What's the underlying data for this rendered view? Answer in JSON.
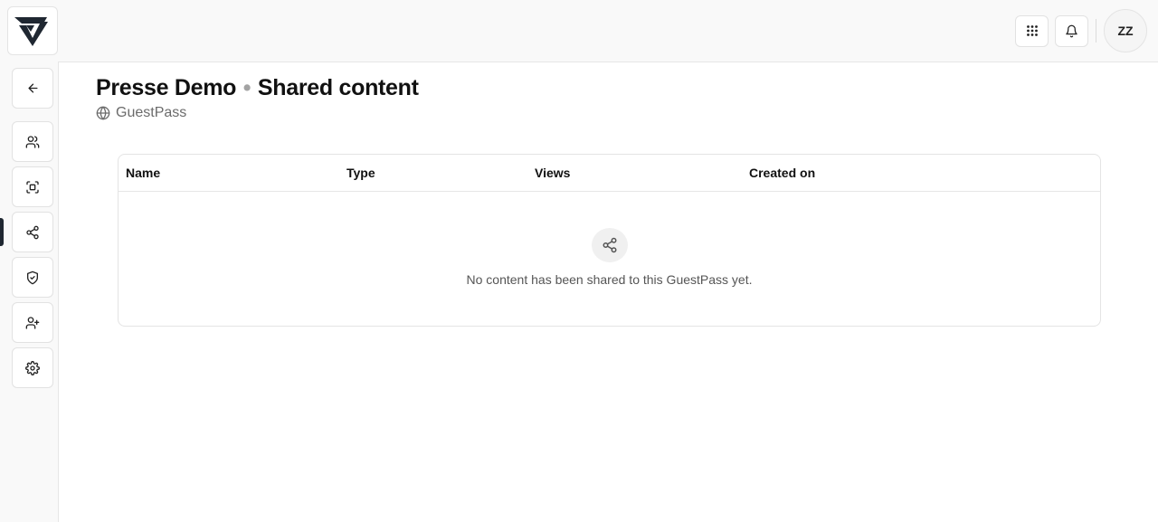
{
  "header": {
    "apps_icon": "grid-icon",
    "notifications_icon": "bell-icon",
    "avatar_initials": "ZZ"
  },
  "sidebar": {
    "items": [
      {
        "name": "back",
        "icon": "arrow-left-icon"
      },
      {
        "name": "users",
        "icon": "users-icon"
      },
      {
        "name": "scan",
        "icon": "scan-icon"
      },
      {
        "name": "share",
        "icon": "share-icon",
        "active": true
      },
      {
        "name": "security",
        "icon": "shield-icon"
      },
      {
        "name": "invite",
        "icon": "user-plus-icon"
      },
      {
        "name": "settings",
        "icon": "gear-icon"
      }
    ]
  },
  "page": {
    "title_main": "Presse Demo",
    "title_separator": "•",
    "title_section": "Shared content",
    "subtitle": "GuestPass"
  },
  "table": {
    "columns": [
      "Name",
      "Type",
      "Views",
      "Created on"
    ],
    "empty_message": "No content has been shared to this GuestPass yet."
  },
  "colors": {
    "accent": "#1f2731",
    "background": "#f9f9f9"
  }
}
